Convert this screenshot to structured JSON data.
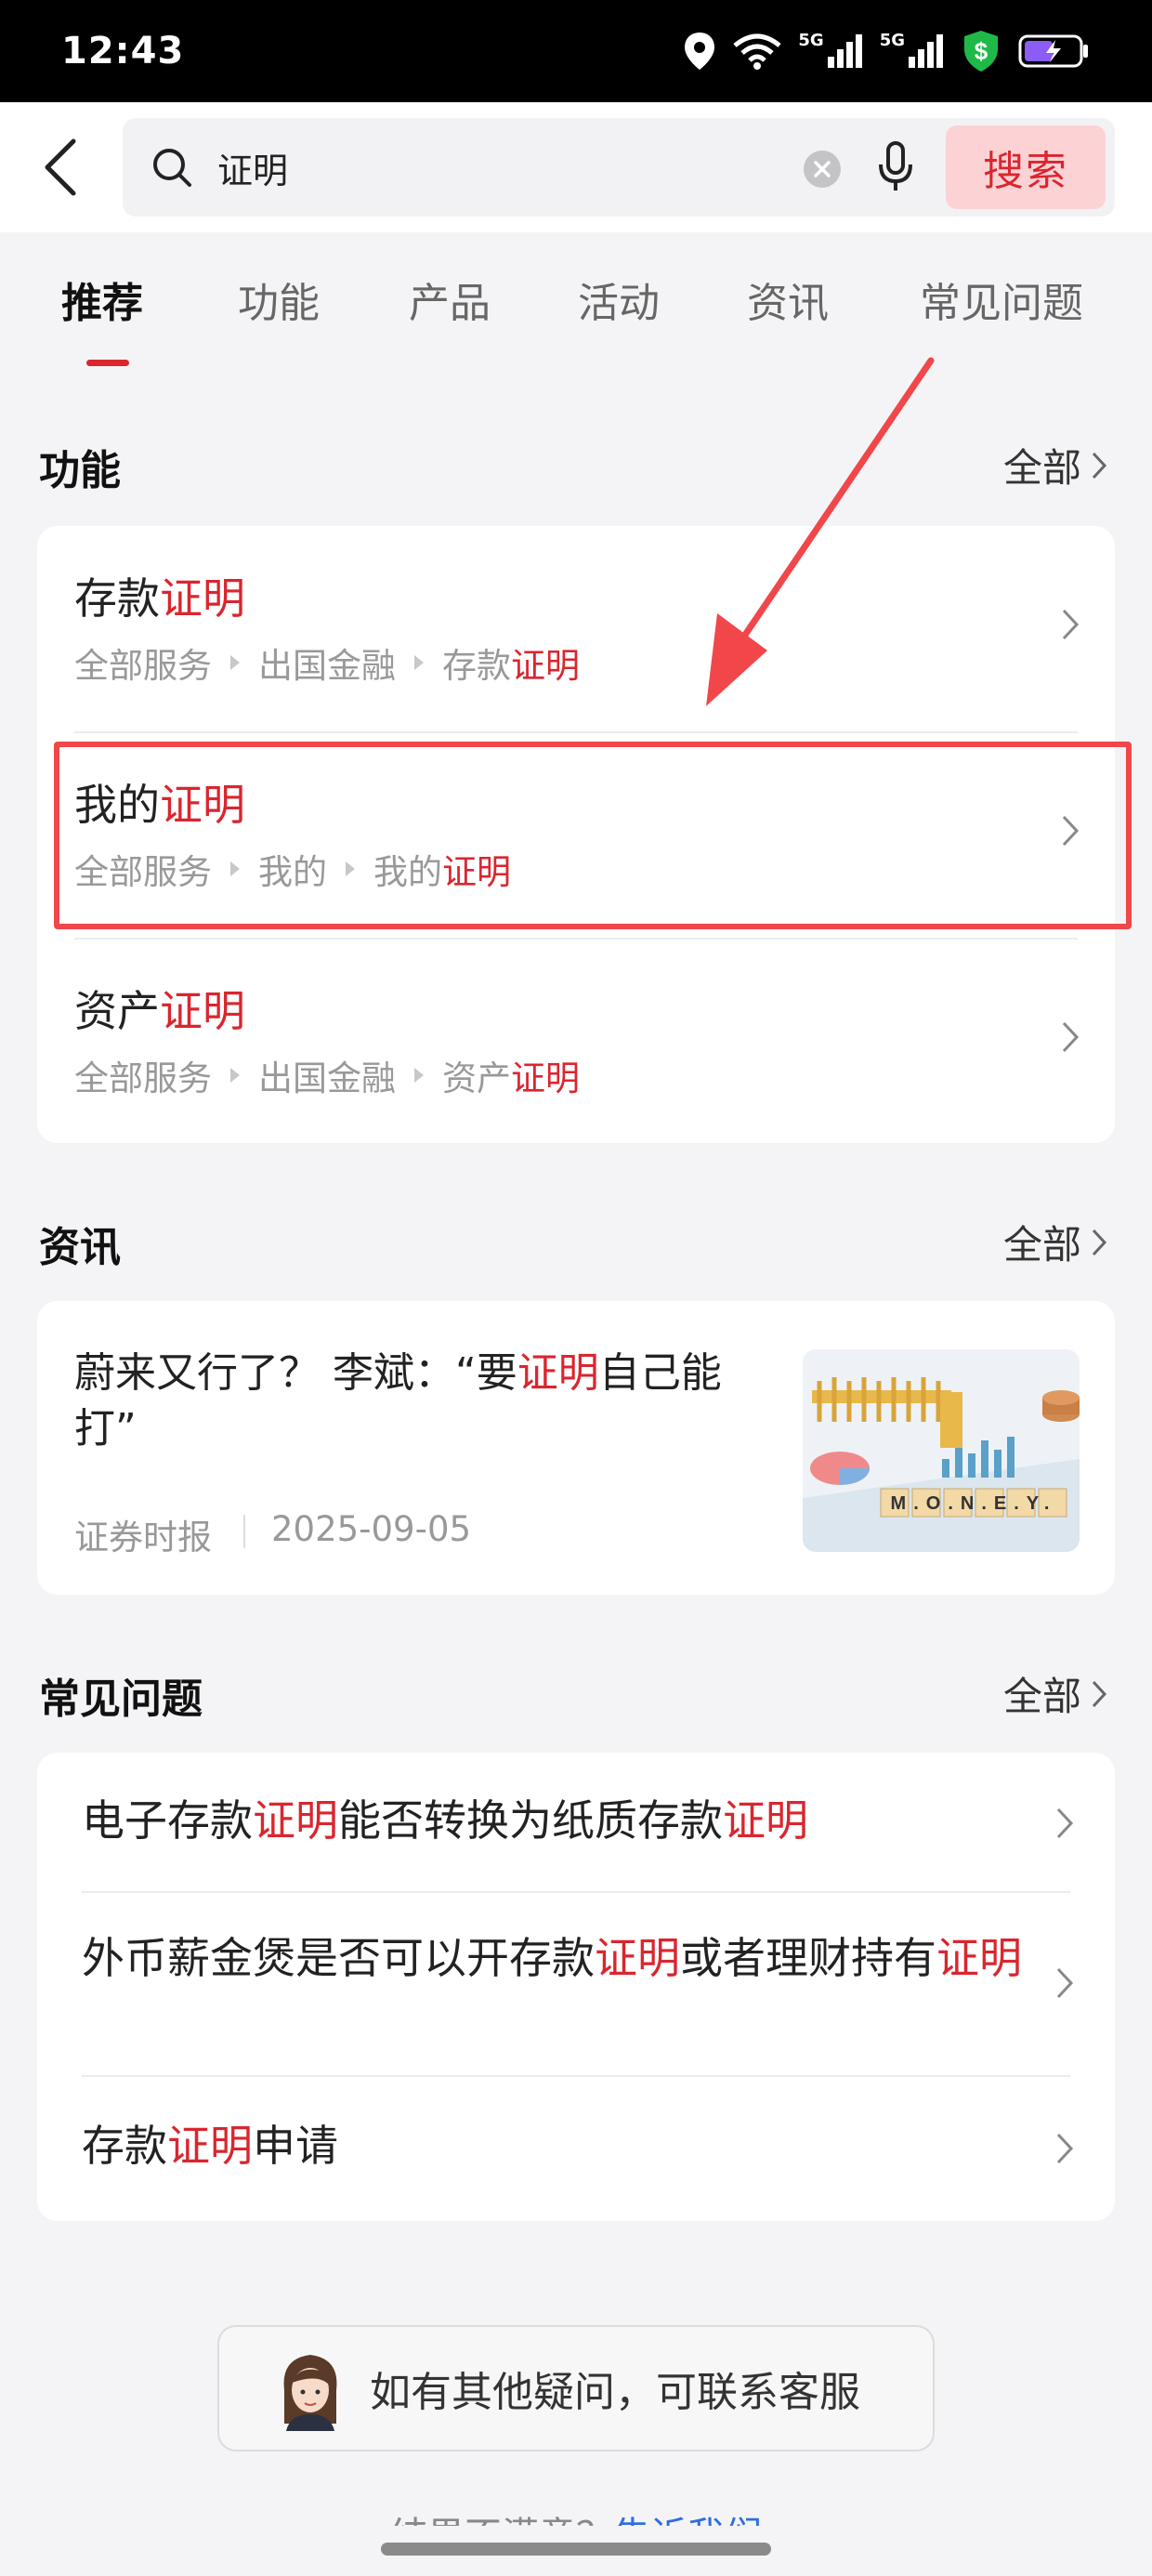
{
  "status_bar": {
    "time": "12:43",
    "net1": "5G",
    "net2": "5G"
  },
  "search": {
    "query": "证明",
    "button_label": "搜索"
  },
  "tabs": [
    {
      "label": "推荐",
      "active": true
    },
    {
      "label": "功能"
    },
    {
      "label": "产品"
    },
    {
      "label": "活动"
    },
    {
      "label": "资讯"
    },
    {
      "label": "常见问题"
    }
  ],
  "functions": {
    "title": "功能",
    "more": "全部",
    "items": [
      {
        "title_pre": "存款",
        "title_hl": "证明",
        "path": [
          "全部服务",
          "出国金融"
        ],
        "path_last_pre": "存款",
        "path_last_hl": "证明"
      },
      {
        "title_pre": "我的",
        "title_hl": "证明",
        "path": [
          "全部服务",
          "我的"
        ],
        "path_last_pre": "我的",
        "path_last_hl": "证明"
      },
      {
        "title_pre": "资产",
        "title_hl": "证明",
        "path": [
          "全部服务",
          "出国金融"
        ],
        "path_last_pre": "资产",
        "path_last_hl": "证明"
      }
    ]
  },
  "news": {
    "title": "资讯",
    "more": "全部",
    "item": {
      "title_pre": "蔚来又行了？ 李斌：“要",
      "title_hl": "证明",
      "title_post": "自己能打”",
      "source": "证券时报",
      "date": "2025-09-05",
      "thumb_text": "M.O.N.E.Y."
    }
  },
  "faq": {
    "title": "常见问题",
    "more": "全部",
    "items": [
      {
        "parts": [
          [
            "电子存款",
            false
          ],
          [
            "证明",
            true
          ],
          [
            "能否转换为纸质存款",
            false
          ],
          [
            "证明",
            true
          ]
        ]
      },
      {
        "parts": [
          [
            "外币薪金煲是否可以开存款",
            false
          ],
          [
            "证明",
            true
          ],
          [
            "或者理财持有",
            false
          ],
          [
            "证明",
            true
          ]
        ]
      },
      {
        "parts": [
          [
            "存款",
            false
          ],
          [
            "证明",
            true
          ],
          [
            "申请",
            false
          ]
        ]
      }
    ]
  },
  "contact": {
    "label": "如有其他疑问，可联系客服"
  },
  "bottom": {
    "text": "结果不满意？",
    "link": "告诉我们"
  },
  "colors": {
    "accent": "#d9262f",
    "highlight_box": "#f1474a",
    "link": "#2f6fe0"
  }
}
